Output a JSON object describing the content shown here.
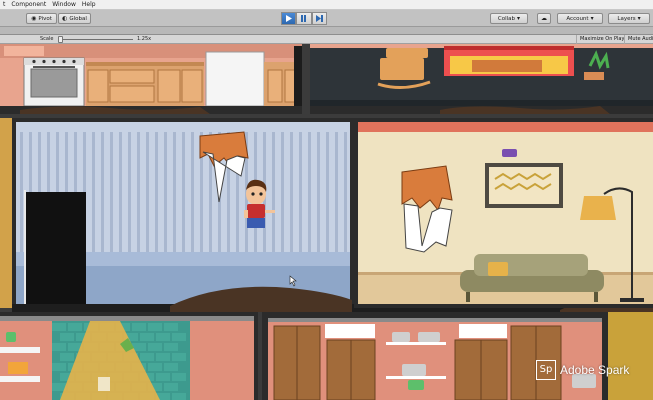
{
  "menubar": {
    "items": [
      "t",
      "Component",
      "Window",
      "Help"
    ]
  },
  "toolbar": {
    "pivot_label": "Pivot",
    "global_label": "Global",
    "collab_label": "Collab",
    "account_label": "Account",
    "layers_label": "Layers",
    "play_state": "playing"
  },
  "game_view": {
    "scale_label": "Scale",
    "scale_value": "1.25x",
    "maximize_label": "Maximize On Play",
    "mute_label": "Mute Audio"
  },
  "scene": {
    "wallpaper_colors": {
      "kitchen": "#e8a48e",
      "living": "#2e3439",
      "hallway": "#c7d2e4",
      "lounge": "#efe3c1",
      "bottom_right": "#e0907c",
      "bottom_left": "#3d9a8e"
    }
  },
  "watermark": {
    "logo_text": "Sp",
    "text": "Adobe Spark"
  },
  "colors": {
    "accent_play": "#2d68b0",
    "toolbar": "#c2c2c2"
  }
}
